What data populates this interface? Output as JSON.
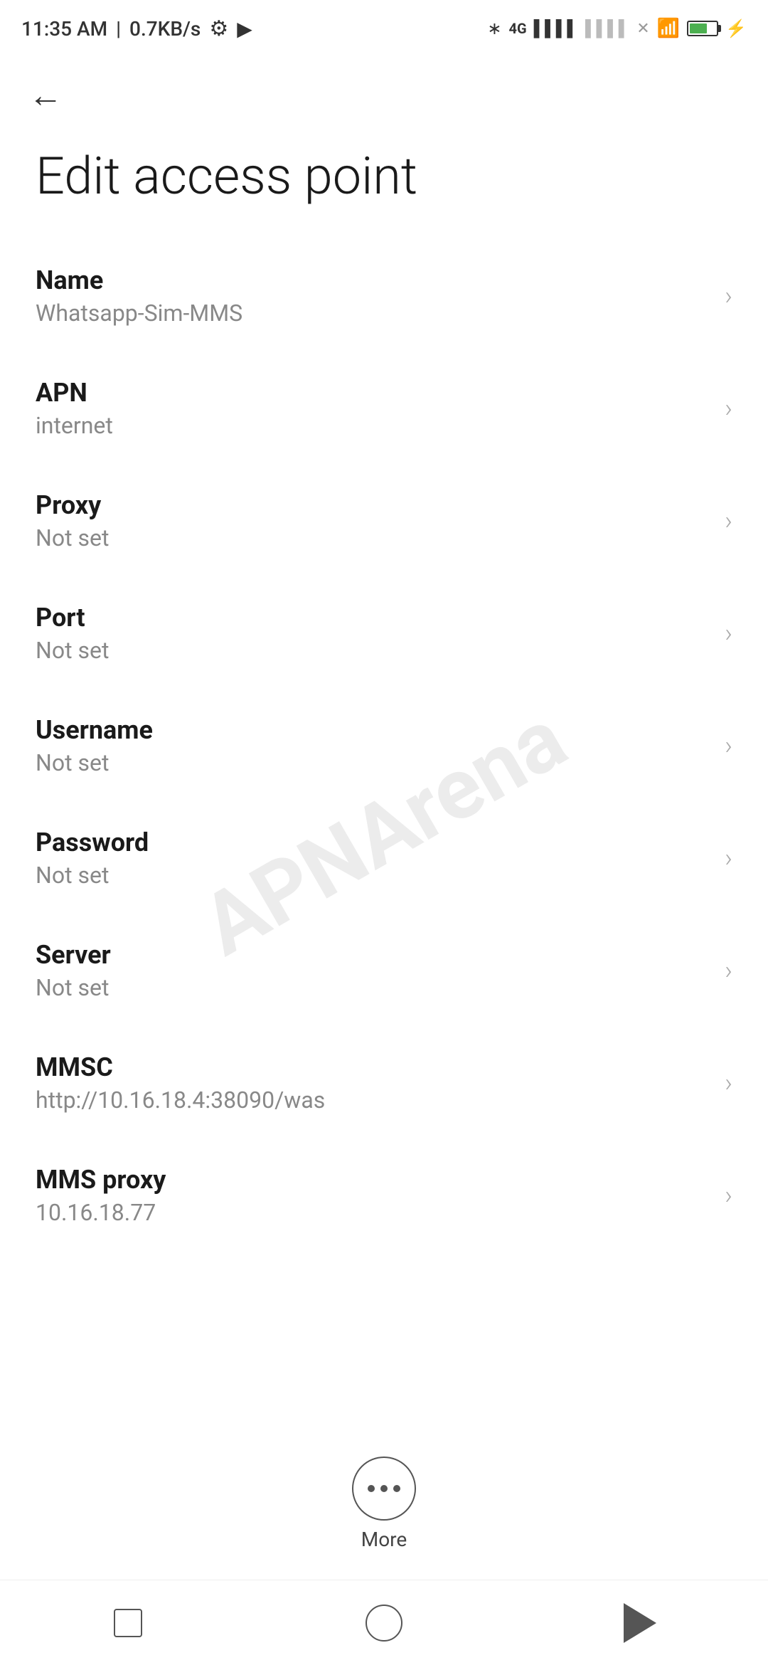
{
  "statusBar": {
    "time": "11:35 AM",
    "speed": "0.7KB/s"
  },
  "page": {
    "title": "Edit access point",
    "backLabel": "←"
  },
  "settings": [
    {
      "id": "name",
      "label": "Name",
      "value": "Whatsapp-Sim-MMS"
    },
    {
      "id": "apn",
      "label": "APN",
      "value": "internet"
    },
    {
      "id": "proxy",
      "label": "Proxy",
      "value": "Not set"
    },
    {
      "id": "port",
      "label": "Port",
      "value": "Not set"
    },
    {
      "id": "username",
      "label": "Username",
      "value": "Not set"
    },
    {
      "id": "password",
      "label": "Password",
      "value": "Not set"
    },
    {
      "id": "server",
      "label": "Server",
      "value": "Not set"
    },
    {
      "id": "mmsc",
      "label": "MMSC",
      "value": "http://10.16.18.4:38090/was"
    },
    {
      "id": "mms-proxy",
      "label": "MMS proxy",
      "value": "10.16.18.77"
    }
  ],
  "more": {
    "label": "More"
  },
  "watermark": "APNArena"
}
